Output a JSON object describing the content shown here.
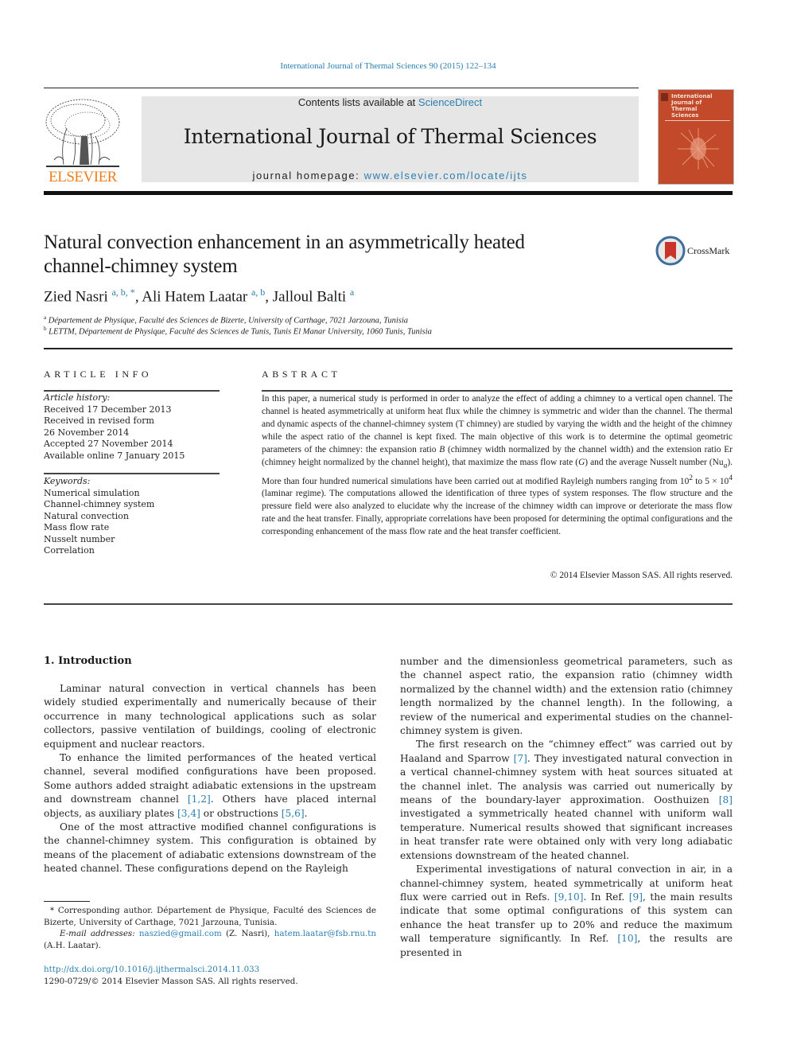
{
  "header": {
    "citation": "International Journal of Thermal Sciences 90 (2015) 122–134",
    "publisher_logo_text": "ELSEVIER",
    "contents_prefix": "Contents lists available at ",
    "contents_link": "ScienceDirect",
    "journal_title": "International Journal of Thermal Sciences",
    "homepage_prefix": "journal homepage: ",
    "homepage_link": "www.elsevier.com/locate/ijts",
    "cover_title_lines": [
      "International",
      "Journal of",
      "Thermal",
      "Sciences"
    ],
    "crossmark_label": "CrossMark"
  },
  "colors": {
    "link": "#2a7fb0",
    "elsevier_orange": "#f07f1e",
    "masthead_bg": "#e6e6e6",
    "cover_bg": "#c24a2a"
  },
  "article": {
    "title_line1": "Natural convection enhancement in an asymmetrically heated",
    "title_line2": "channel-chimney system",
    "authors": [
      {
        "name": "Zied Nasri",
        "marks": "a, b, *"
      },
      {
        "name": "Ali Hatem Laatar",
        "marks": "a, b"
      },
      {
        "name": "Jalloul Balti",
        "marks": "a"
      }
    ],
    "affiliations": [
      {
        "mark": "a",
        "text": "Département de Physique, Faculté des Sciences de Bizerte, University of Carthage, 7021 Jarzouna, Tunisia"
      },
      {
        "mark": "b",
        "text": "LETTM, Département de Physique, Faculté des Sciences de Tunis, Tunis El Manar University, 1060 Tunis, Tunisia"
      }
    ]
  },
  "article_info": {
    "heading": "ARTICLE INFO",
    "history_label": "Article history:",
    "history": [
      "Received 17 December 2013",
      "Received in revised form",
      "26 November 2014",
      "Accepted 27 November 2014",
      "Available online 7 January 2015"
    ],
    "keywords_label": "Keywords:",
    "keywords": [
      "Numerical simulation",
      "Channel-chimney system",
      "Natural convection",
      "Mass flow rate",
      "Nusselt number",
      "Correlation"
    ]
  },
  "abstract": {
    "heading": "ABSTRACT",
    "p1": "In this paper, a numerical study is performed in order to analyze the effect of adding a chimney to a vertical open channel. The channel is heated asymmetrically at uniform heat flux while the chimney is symmetric and wider than the channel. The thermal and dynamic aspects of the channel-chimney system (T chimney) are studied by varying the width and the height of the chimney while the aspect ratio of the channel is kept fixed. The main objective of this work is to determine the optimal geometric parameters of the chimney: the expansion ratio ",
    "var_B": "B",
    "p2": " (chimney width normalized by the channel width) and the extension ratio Er (chimney height normalized by the channel height), that maximize the mass flow rate (",
    "var_G": "G",
    "p3": ") and the average Nusselt number (Nu",
    "sub_a": "a",
    "p4": "). More than four hundred numerical simulations have been carried out at modified Rayleigh numbers ranging from 10",
    "exp1": "2",
    "p5": " to 5 × 10",
    "exp2": "4",
    "p6": " (laminar regime). The computations allowed the identification of three types of system responses. The flow structure and the pressure field were also analyzed to elucidate why the increase of the chimney width can improve or deteriorate the mass flow rate and the heat transfer. Finally, appropriate correlations have been proposed for determining the optimal configurations and the corresponding enhancement of the mass flow rate and the heat transfer coefficient.",
    "copyright": "© 2014 Elsevier Masson SAS. All rights reserved."
  },
  "intro": {
    "heading": "1.  Introduction",
    "left": {
      "para1": "Laminar natural convection in vertical channels has been widely studied experimentally and numerically because of their occurrence in many technological applications such as solar collectors, passive ventilation of buildings, cooling of electronic equipment and nuclear reactors.",
      "para2_a": "To enhance the limited performances of the heated vertical channel, several modified configurations have been proposed. Some authors added straight adiabatic extensions in the upstream and downstream channel ",
      "ref_1_2": "[1,2]",
      "para2_b": ". Others have placed internal objects, as auxiliary plates ",
      "ref_3_4": "[3,4]",
      "para2_c": " or obstructions ",
      "ref_5_6": "[5,6]",
      "para2_d": ".",
      "para3": "One of the most attractive modified channel configurations is the channel-chimney system. This configuration is obtained by means of the placement of adiabatic extensions downstream of the heated channel. These configurations depend on the Rayleigh"
    },
    "right": {
      "para1": "number and the dimensionless geometrical parameters, such as the channel aspect ratio, the expansion ratio (chimney width normalized by the channel width) and the extension ratio (chimney length normalized by the channel length). In the following, a review of the numerical and experimental studies on the channel-chimney system is given.",
      "para2_a": "The first research on the “chimney effect” was carried out by Haaland and Sparrow ",
      "ref_7": "[7]",
      "para2_b": ". They investigated natural convection in a vertical channel-chimney system with heat sources situated at the channel inlet. The analysis was carried out numerically by means of the boundary-layer approximation. Oosthuizen ",
      "ref_8": "[8]",
      "para2_c": " investigated a symmetrically heated channel with uniform wall temperature. Numerical results showed that significant increases in heat transfer rate were obtained only with very long adiabatic extensions downstream of the heated channel.",
      "para3_a": "Experimental investigations of natural convection in air, in a channel-chimney system, heated symmetrically at uniform heat flux were carried out in Refs. ",
      "ref_9_10": "[9,10]",
      "para3_b": ". In Ref. ",
      "ref_9": "[9]",
      "para3_c": ", the main results indicate that some optimal configurations of this system can enhance the heat transfer up to 20% and reduce the maximum wall temperature significantly. In Ref. ",
      "ref_10": "[10]",
      "para3_d": ", the results are presented in"
    }
  },
  "footnote": {
    "corresponding": "* Corresponding author. Département de Physique, Faculté des Sciences de Bizerte, University of Carthage, 7021 Jarzouna, Tunisia.",
    "email_label": "E-mail addresses:",
    "email1": "naszied@gmail.com",
    "email1_owner": " (Z. Nasri), ",
    "email2": "hatem.laatar@fsb.rnu.tn",
    "email2_owner": " (A.H. Laatar).",
    "doi": "http://dx.doi.org/10.1016/j.ijthermalsci.2014.11.033",
    "issn": "1290-0729/© 2014 Elsevier Masson SAS. All rights reserved."
  }
}
